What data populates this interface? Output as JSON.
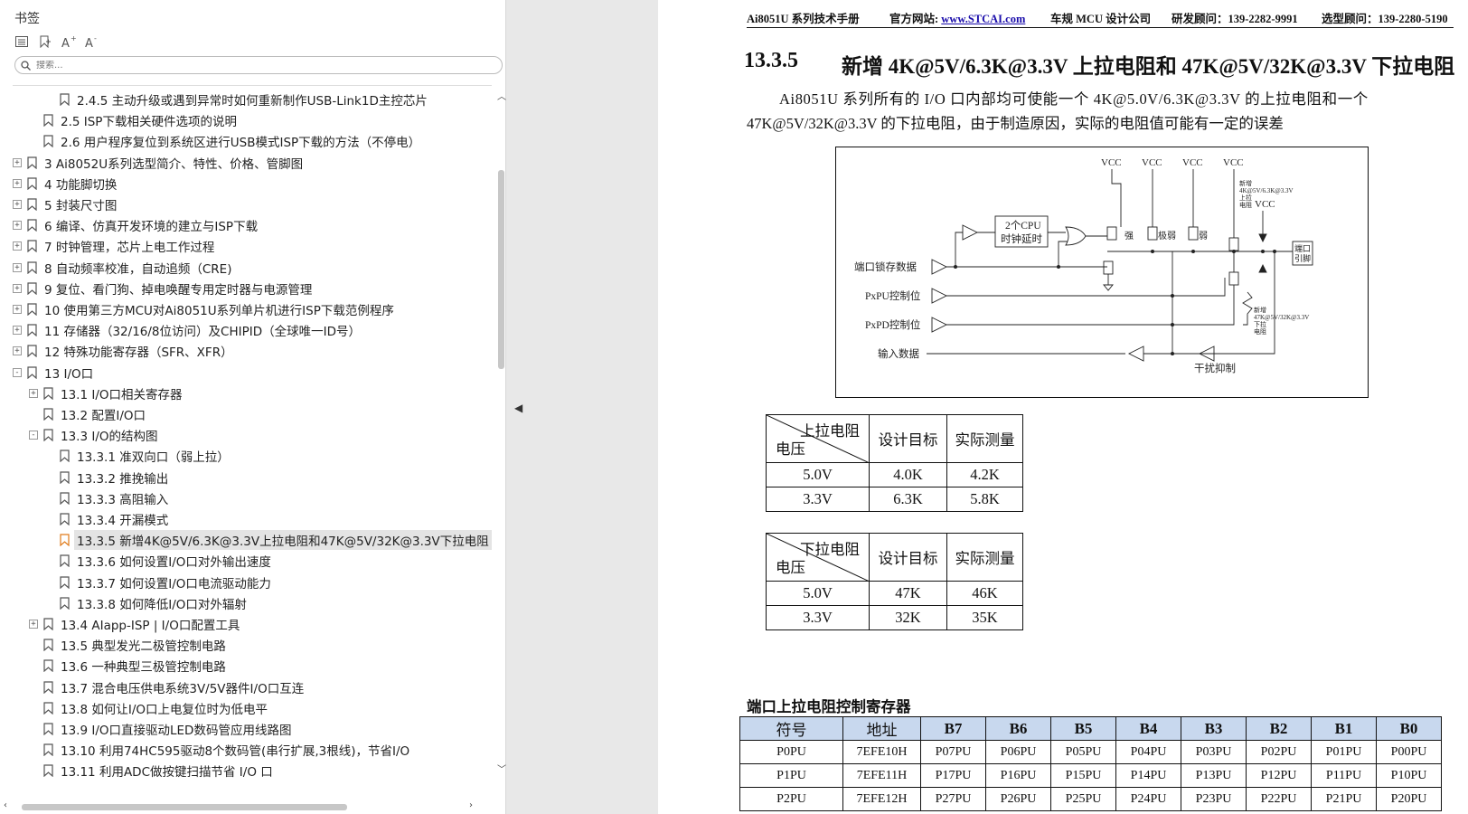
{
  "bookmarks": {
    "title": "书签",
    "search_placeholder": "搜索...",
    "items": [
      {
        "label": "2.4.5  主动升级或遇到异常时如何重新制作USB-Link1D主控芯片",
        "level": 2,
        "expand": null
      },
      {
        "label": "2.5  ISP下载相关硬件选项的说明",
        "level": 1,
        "expand": null
      },
      {
        "label": "2.6  用户程序复位到系统区进行USB模式ISP下载的方法（不停电）",
        "level": 1,
        "expand": null
      },
      {
        "label": "3  Ai8052U系列选型简介、特性、价格、管脚图",
        "level": 0,
        "expand": "+"
      },
      {
        "label": "4  功能脚切换",
        "level": 0,
        "expand": "+"
      },
      {
        "label": "5  封装尺寸图",
        "level": 0,
        "expand": "+"
      },
      {
        "label": "6  编译、仿真开发环境的建立与ISP下载",
        "level": 0,
        "expand": "+"
      },
      {
        "label": "7  时钟管理，芯片上电工作过程",
        "level": 0,
        "expand": "+"
      },
      {
        "label": "8  自动频率校准，自动追频（CRE)",
        "level": 0,
        "expand": "+"
      },
      {
        "label": "9  复位、看门狗、掉电唤醒专用定时器与电源管理",
        "level": 0,
        "expand": "+"
      },
      {
        "label": "10  使用第三方MCU对Ai8051U系列单片机进行ISP下载范例程序",
        "level": 0,
        "expand": "+"
      },
      {
        "label": "11  存储器（32/16/8位访问）及CHIPID（全球唯一ID号）",
        "level": 0,
        "expand": "+"
      },
      {
        "label": "12  特殊功能寄存器（SFR、XFR）",
        "level": 0,
        "expand": "+"
      },
      {
        "label": "13  I/O口",
        "level": 0,
        "expand": "-"
      },
      {
        "label": "13.1  I/O口相关寄存器",
        "level": 1,
        "expand": "+"
      },
      {
        "label": "13.2  配置I/O口",
        "level": 1,
        "expand": null
      },
      {
        "label": "13.3  I/O的结构图",
        "level": 1,
        "expand": "-"
      },
      {
        "label": "13.3.1  准双向口（弱上拉）",
        "level": 2,
        "expand": null
      },
      {
        "label": "13.3.2  推挽输出",
        "level": 2,
        "expand": null
      },
      {
        "label": "13.3.3  高阻输入",
        "level": 2,
        "expand": null
      },
      {
        "label": "13.3.4  开漏模式",
        "level": 2,
        "expand": null
      },
      {
        "label": "13.3.5  新增4K@5V/6.3K@3.3V上拉电阻和47K@5V/32K@3.3V下拉电阻",
        "level": 2,
        "expand": null,
        "selected": true
      },
      {
        "label": "13.3.6  如何设置I/O口对外输出速度",
        "level": 2,
        "expand": null
      },
      {
        "label": "13.3.7  如何设置I/O口电流驱动能力",
        "level": 2,
        "expand": null
      },
      {
        "label": "13.3.8  如何降低I/O口对外辐射",
        "level": 2,
        "expand": null
      },
      {
        "label": "13.4  AIapp-ISP | I/O口配置工具",
        "level": 1,
        "expand": "+"
      },
      {
        "label": "13.5  典型发光二极管控制电路",
        "level": 1,
        "expand": null
      },
      {
        "label": "13.6  一种典型三极管控制电路",
        "level": 1,
        "expand": null
      },
      {
        "label": "13.7  混合电压供电系统3V/5V器件I/O口互连",
        "level": 1,
        "expand": null
      },
      {
        "label": "13.8  如何让I/O口上电复位时为低电平",
        "level": 1,
        "expand": null
      },
      {
        "label": "13.9  I/O口直接驱动LED数码管应用线路图",
        "level": 1,
        "expand": null
      },
      {
        "label": "13.10  利用74HC595驱动8个数码管(串行扩展,3根线)，节省I/O",
        "level": 1,
        "expand": null
      },
      {
        "label": "13.11  利用ADC做按键扫描节省 I/O 口",
        "level": 1,
        "expand": null
      }
    ]
  },
  "document": {
    "header": {
      "manual": "Ai8051U 系列技术手册",
      "site_label": "官方网站: ",
      "site_link": "www.STCAI.com",
      "design": "车规 MCU 设计公司",
      "rd": "研发顾问：139-2282-9991",
      "sel": "选型顾问：139-2280-5190"
    },
    "section_number": "13.3.5",
    "section_title": "新增 4K@5V/6.3K@3.3V 上拉电阻和 47K@5V/32K@3.3V 下拉电阻",
    "paragraph_line1": "Ai8051U 系列所有的 I/O 口内部均可使能一个 4K@5.0V/6.3K@3.3V 的上拉电阻和一个",
    "paragraph_line2": "47K@5V/32K@3.3V 的下拉电阻，由于制造原因，实际的电阻值可能有一定的误差",
    "diagram": {
      "vcc": "VCC",
      "cpu_delay_1": "2个CPU",
      "cpu_delay_2": "时钟延时",
      "strong": "强",
      "very_weak": "极弱",
      "weak": "弱",
      "pullup_note": [
        "新增",
        "4K@5V/6.3K@3.3V",
        "上拉",
        "电阻"
      ],
      "pulldown_note": [
        "新增",
        "47K@5V/32K@3.3V",
        "下拉",
        "电阻"
      ],
      "port_pin_1": "端口",
      "port_pin_2": "引脚",
      "latch_data": "端口锁存数据",
      "pxpu": "PxPU控制位",
      "pxpd": "PxPD控制位",
      "input_data": "输入数据",
      "noise": "干扰抑制"
    },
    "pullup_table": {
      "corner_top": "上拉电阻",
      "corner_bottom": "电压",
      "headers": [
        "设计目标",
        "实际测量"
      ],
      "rows": [
        [
          "5.0V",
          "4.0K",
          "4.2K"
        ],
        [
          "3.3V",
          "6.3K",
          "5.8K"
        ]
      ]
    },
    "pulldown_table": {
      "corner_top": "下拉电阻",
      "corner_bottom": "电压",
      "headers": [
        "设计目标",
        "实际测量"
      ],
      "rows": [
        [
          "5.0V",
          "47K",
          "46K"
        ],
        [
          "3.3V",
          "32K",
          "35K"
        ]
      ]
    },
    "register_table": {
      "title": "端口上拉电阻控制寄存器",
      "headers": [
        "符号",
        "地址",
        "B7",
        "B6",
        "B5",
        "B4",
        "B3",
        "B2",
        "B1",
        "B0"
      ],
      "rows": [
        [
          "P0PU",
          "7EFE10H",
          "P07PU",
          "P06PU",
          "P05PU",
          "P04PU",
          "P03PU",
          "P02PU",
          "P01PU",
          "P00PU"
        ],
        [
          "P1PU",
          "7EFE11H",
          "P17PU",
          "P16PU",
          "P15PU",
          "P14PU",
          "P13PU",
          "P12PU",
          "P11PU",
          "P10PU"
        ],
        [
          "P2PU",
          "7EFE12H",
          "P27PU",
          "P26PU",
          "P25PU",
          "P24PU",
          "P23PU",
          "P22PU",
          "P21PU",
          "P20PU"
        ]
      ]
    }
  },
  "colors": {
    "accent_selected_icon": "#e07b1a",
    "register_header_bg": "#c8d8ee",
    "link": "#1a0dab"
  }
}
